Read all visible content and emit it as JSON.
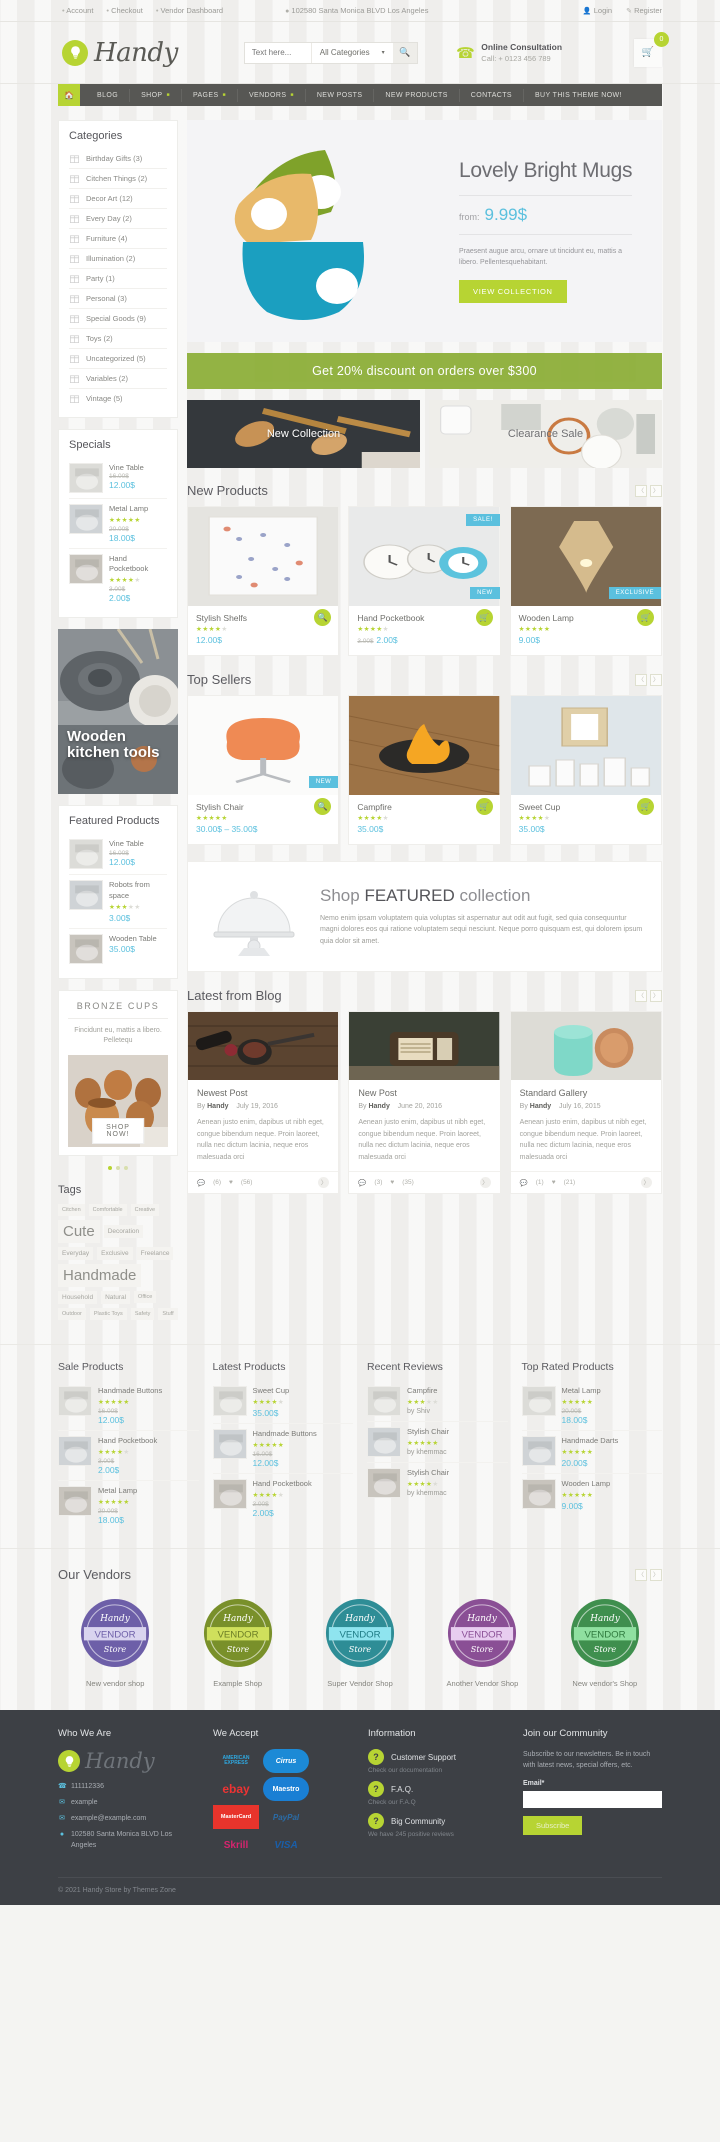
{
  "topbar": {
    "links": [
      "Account",
      "Checkout",
      "Vendor Dashboard"
    ],
    "address": "102580 Santa Monica BLVD Los Angeles",
    "login": "Login",
    "register": "Register"
  },
  "header": {
    "brand": "Handy",
    "search_placeholder": "Text here...",
    "category_select": "All Categories",
    "consult_title": "Online Consultation",
    "consult_phone": "Call: + 0123 456 789",
    "cart_count": "0"
  },
  "nav": {
    "items": [
      {
        "label": "BLOG",
        "caret": false
      },
      {
        "label": "SHOP",
        "caret": true
      },
      {
        "label": "PAGES",
        "caret": true
      },
      {
        "label": "VENDORS",
        "caret": true
      },
      {
        "label": "NEW POSTS",
        "caret": false
      },
      {
        "label": "NEW PRODUCTS",
        "caret": false
      },
      {
        "label": "CONTACTS",
        "caret": false
      },
      {
        "label": "BUY THIS THEME NOW!",
        "caret": false
      }
    ]
  },
  "sidebar": {
    "categories_title": "Categories",
    "categories": [
      {
        "label": "Birthday Gifts (3)"
      },
      {
        "label": "Citchen Things (2)"
      },
      {
        "label": "Decor Art (12)"
      },
      {
        "label": "Every Day (2)"
      },
      {
        "label": "Furniture (4)"
      },
      {
        "label": "Illumination (2)"
      },
      {
        "label": "Party (1)"
      },
      {
        "label": "Personal (3)"
      },
      {
        "label": "Special Goods (9)"
      },
      {
        "label": "Toys (2)"
      },
      {
        "label": "Uncategorized (5)"
      },
      {
        "label": "Variables (2)"
      },
      {
        "label": "Vintage (5)"
      }
    ],
    "specials_title": "Specials",
    "specials": [
      {
        "name": "Vine Table",
        "stars": 0,
        "old": "16.00$",
        "price": "12.00$"
      },
      {
        "name": "Metal Lamp",
        "stars": 5,
        "old": "20.00$",
        "price": "18.00$"
      },
      {
        "name": "Hand Pocketbook",
        "stars": 4,
        "old": "3.00$",
        "price": "2.00$"
      }
    ],
    "banner_caption": "Wooden kitchen tools",
    "featured_title": "Featured Products",
    "featured": [
      {
        "name": "Vine Table",
        "stars": 0,
        "old": "16.00$",
        "price": "12.00$"
      },
      {
        "name": "Robots from space",
        "stars": 3,
        "old": "",
        "price": "3.00$"
      },
      {
        "name": "Wooden Table",
        "stars": 0,
        "old": "",
        "price": "35.00$"
      }
    ],
    "promo": {
      "title": "BRONZE CUPS",
      "text": "Fincidunt eu, mattis a libero. Pelletequ",
      "button": "SHOP NOW!"
    },
    "tags_title": "Tags",
    "tags": [
      {
        "label": "Citchen",
        "size": "sm"
      },
      {
        "label": "Comfortable",
        "size": "sm"
      },
      {
        "label": "Creative",
        "size": "sm"
      },
      {
        "label": "Cute",
        "size": "lg"
      },
      {
        "label": "Decoration",
        "size": "md"
      },
      {
        "label": "Everyday",
        "size": "md"
      },
      {
        "label": "Exclusive",
        "size": "md"
      },
      {
        "label": "Freelance",
        "size": "md"
      },
      {
        "label": "Handmade",
        "size": "lg"
      },
      {
        "label": "Household",
        "size": "md"
      },
      {
        "label": "Natural",
        "size": "md"
      },
      {
        "label": "Office",
        "size": "sm"
      },
      {
        "label": "Outdoor",
        "size": "sm"
      },
      {
        "label": "Plastic Toys",
        "size": "sm"
      },
      {
        "label": "Safety",
        "size": "sm"
      },
      {
        "label": "Stuff",
        "size": "sm"
      }
    ]
  },
  "hero": {
    "title": "Lovely Bright Mugs",
    "from_label": "from:",
    "price": "9.99$",
    "text": "Praesent augue arcu, ornare ut tincidunt eu, mattis a libero. Pellentesquehabitant.",
    "button": "VIEW COLLECTION"
  },
  "greenbar": "Get 20% discount on orders over $300",
  "promos": [
    {
      "label": "New Collection",
      "dark": false
    },
    {
      "label": "Clearance Sale",
      "dark": true
    }
  ],
  "new_products": {
    "title": "New Products",
    "items": [
      {
        "name": "Stylish Shelfs",
        "stars": 4,
        "old": "",
        "price": "12.00$",
        "ribbon": "",
        "ribbon2": "",
        "action": "search"
      },
      {
        "name": "Hand Pocketbook",
        "stars": 4,
        "old": "3.00$",
        "price": "2.00$",
        "ribbon": "SALE!",
        "ribbon2": "NEW",
        "action": "cart"
      },
      {
        "name": "Wooden Lamp",
        "stars": 5,
        "old": "",
        "price": "9.00$",
        "ribbon": "",
        "ribbon2": "EXCLUSIVE",
        "action": "cart"
      }
    ]
  },
  "top_sellers": {
    "title": "Top Sellers",
    "items": [
      {
        "name": "Stylish Chair",
        "stars": 5,
        "old": "",
        "price": "30.00$ – 35.00$",
        "ribbon": "",
        "ribbon2": "NEW",
        "action": "search"
      },
      {
        "name": "Campfire",
        "stars": 4,
        "old": "",
        "price": "35.00$",
        "ribbon": "",
        "ribbon2": "",
        "action": "cart"
      },
      {
        "name": "Sweet Cup",
        "stars": 4,
        "old": "",
        "price": "35.00$",
        "ribbon": "",
        "ribbon2": "",
        "action": "cart"
      }
    ]
  },
  "featured_band": {
    "title_pre": "Shop ",
    "title_bold": "FEATURED",
    "title_post": " collection",
    "text": "Nemo enim ipsam voluptatem quia voluptas sit aspernatur aut odit aut fugit, sed quia consequuntur magni dolores eos qui ratione voluptatem sequi nesciunt. Neque porro quisquam est, qui dolorem ipsum quia dolor sit amet."
  },
  "blog": {
    "title": "Latest from Blog",
    "posts": [
      {
        "title": "Newest Post",
        "by": "By",
        "author": "Handy",
        "date": "July 19, 2016",
        "excerpt": "Aenean justo enim, dapibus ut nibh eget, congue bibendum neque. Proin laoreet, nulla nec dictum lacinia, neque eros malesuada orci",
        "comments": "(6)",
        "likes": "(56)"
      },
      {
        "title": "New Post",
        "by": "By",
        "author": "Handy",
        "date": "June 20, 2016",
        "excerpt": "Aenean justo enim, dapibus ut nibh eget, congue bibendum neque. Proin laoreet, nulla nec dictum lacinia, neque eros malesuada orci",
        "comments": "(3)",
        "likes": "(35)"
      },
      {
        "title": "Standard Gallery",
        "by": "By",
        "author": "Handy",
        "date": "July 16, 2015",
        "excerpt": "Aenean justo enim, dapibus ut nibh eget, congue bibendum neque. Proin laoreet, nulla nec dictum lacinia, neque eros malesuada orci",
        "comments": "(1)",
        "likes": "(21)"
      }
    ]
  },
  "widgets": [
    {
      "title": "Sale Products",
      "items": [
        {
          "name": "Handmade Buttons",
          "stars": 5,
          "old": "16.00$",
          "price": "12.00$",
          "by": ""
        },
        {
          "name": "Hand Pocketbook",
          "stars": 4,
          "old": "3.00$",
          "price": "2.00$",
          "by": ""
        },
        {
          "name": "Metal Lamp",
          "stars": 5,
          "old": "20.00$",
          "price": "18.00$",
          "by": ""
        }
      ]
    },
    {
      "title": "Latest Products",
      "items": [
        {
          "name": "Sweet Cup",
          "stars": 4,
          "old": "",
          "price": "35.00$",
          "by": ""
        },
        {
          "name": "Handmade Buttons",
          "stars": 5,
          "old": "16.00$",
          "price": "12.00$",
          "by": ""
        },
        {
          "name": "Hand Pocketbook",
          "stars": 4,
          "old": "3.00$",
          "price": "2.00$",
          "by": ""
        }
      ]
    },
    {
      "title": "Recent Reviews",
      "items": [
        {
          "name": "Campfire",
          "stars": 3,
          "old": "",
          "price": "",
          "by": "by Shiv"
        },
        {
          "name": "Stylish Chair",
          "stars": 5,
          "old": "",
          "price": "",
          "by": "by khemmac"
        },
        {
          "name": "Stylish Chair",
          "stars": 4,
          "old": "",
          "price": "",
          "by": "by khemmac"
        }
      ]
    },
    {
      "title": "Top Rated Products",
      "items": [
        {
          "name": "Metal Lamp",
          "stars": 5,
          "old": "20.00$",
          "price": "18.00$",
          "by": ""
        },
        {
          "name": "Handmade Darts",
          "stars": 5,
          "old": "",
          "price": "20.00$",
          "by": ""
        },
        {
          "name": "Wooden Lamp",
          "stars": 5,
          "old": "",
          "price": "9.00$",
          "by": ""
        }
      ]
    }
  ],
  "vendors": {
    "title": "Our Vendors",
    "badge_top": "Handy",
    "badge_mid": "VENDOR",
    "badge_bot": "Store",
    "items": [
      {
        "name": "New vendor shop",
        "color": "#6d5fa8",
        "ribbon": "#d9d4ef",
        "text": "#6d5fa8"
      },
      {
        "name": "Example Shop",
        "color": "#79902a",
        "ribbon": "#cfe05c",
        "text": "#6d7f26"
      },
      {
        "name": "Super Vendor Shop",
        "color": "#2e8d96",
        "ribbon": "#8fe4ef",
        "text": "#1e7b85"
      },
      {
        "name": "Another Vendor Shop",
        "color": "#8a4f95",
        "ribbon": "#e8cdf0",
        "text": "#8a4f95"
      },
      {
        "name": "New vendor's Shop",
        "color": "#3f8f4e",
        "ribbon": "#8fe0a0",
        "text": "#2f7a3e"
      }
    ]
  },
  "footer": {
    "who_title": "Who We Are",
    "brand": "Handy",
    "contacts": [
      {
        "icon": "phone-icon",
        "text": "111112336"
      },
      {
        "icon": "skype-icon",
        "text": "example"
      },
      {
        "icon": "mail-icon",
        "text": "example@example.com"
      },
      {
        "icon": "pin-icon",
        "text": "102580 Santa Monica BLVD Los Angeles"
      }
    ],
    "accept_title": "We Accept",
    "payments": [
      "AMERICAN EXPRESS",
      "Cirrus",
      "ebay",
      "Maestro",
      "MasterCard",
      "PayPal",
      "Skrill",
      "VISA"
    ],
    "info_title": "Information",
    "info": [
      {
        "label": "Customer Support",
        "sub": "Check our documentation",
        "icon": "lifebuoy-icon"
      },
      {
        "label": "F.A.Q.",
        "sub": "Check our F.A.Q",
        "icon": "question-icon"
      },
      {
        "label": "Big Community",
        "sub": "We have 245 positive reviews",
        "icon": "thumb-up-icon"
      }
    ],
    "join_title": "Join our Community",
    "join_text": "Subscribe to our newsletters. Be in touch with latest news, special offers, etc.",
    "email_label": "Email*",
    "subscribe": "Subscribe",
    "copyright": "© 2021  Handy Store by Themes Zone"
  }
}
